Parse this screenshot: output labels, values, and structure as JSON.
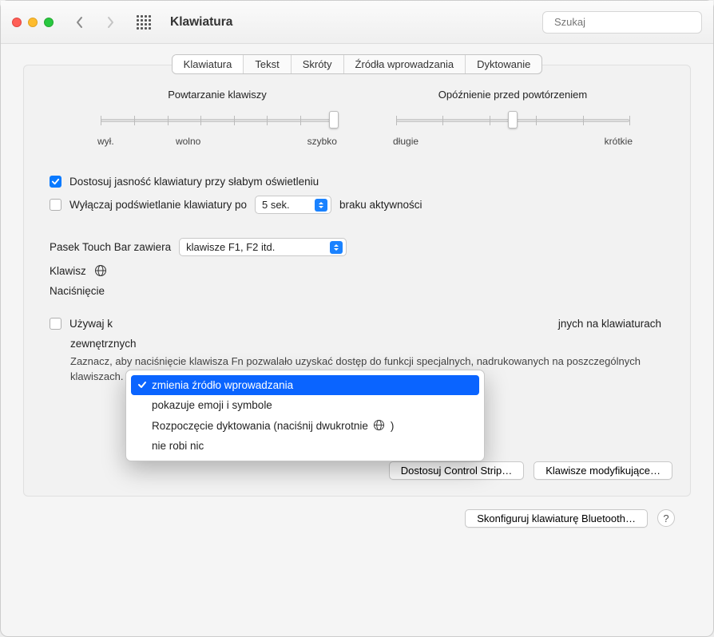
{
  "toolbar": {
    "title": "Klawiatura",
    "search_placeholder": "Szukaj"
  },
  "tabs": [
    {
      "label": "Klawiatura",
      "active": true
    },
    {
      "label": "Tekst",
      "active": false
    },
    {
      "label": "Skróty",
      "active": false
    },
    {
      "label": "Źródła wprowadzania",
      "active": false
    },
    {
      "label": "Dyktowanie",
      "active": false
    }
  ],
  "sliders": {
    "repeat": {
      "title": "Powtarzanie klawiszy",
      "left": "wył.",
      "mid": "wolno",
      "right": "szybko",
      "position": 1.0
    },
    "delay": {
      "title": "Opóźnienie przed powtórzeniem",
      "left": "długie",
      "right": "krótkie",
      "position": 0.5
    }
  },
  "checks": {
    "adjust_brightness": "Dostosuj jasność klawiatury przy słabym oświetleniu",
    "turn_off_backlight_prefix": "Wyłączaj podświetlanie klawiatury po",
    "turn_off_backlight_value": "5 sek.",
    "turn_off_backlight_suffix": "braku aktywności",
    "use_fn_prefix": "Używaj k",
    "use_fn_suffix": "jnych na klawiaturach",
    "use_fn_line2": "zewnętrznych"
  },
  "touchbar_row": {
    "label": "Pasek Touch Bar zawiera",
    "value": "klawisze F1, F2 itd."
  },
  "globe_row": {
    "label_prefix": "Klawisz"
  },
  "press_row": {
    "label": "Naciśnięcie"
  },
  "fn_hint": "Zaznacz, aby naciśnięcie klawisza Fn pozwalało uzyskać dostęp do funkcji specjalnych, nadrukowanych na poszczególnych klawiszach.",
  "footer": {
    "customize_control_strip": "Dostosuj Control Strip…",
    "modifier_keys": "Klawisze modyfikujące…",
    "bluetooth_keyboard": "Skonfiguruj klawiaturę Bluetooth…"
  },
  "menu": {
    "items": [
      "zmienia źródło wprowadzania",
      "pokazuje emoji i symbole",
      "Rozpoczęcie dyktowania (naciśnij dwukrotnie",
      "nie robi nic"
    ],
    "selected_index": 0,
    "closing_paren": ")"
  }
}
